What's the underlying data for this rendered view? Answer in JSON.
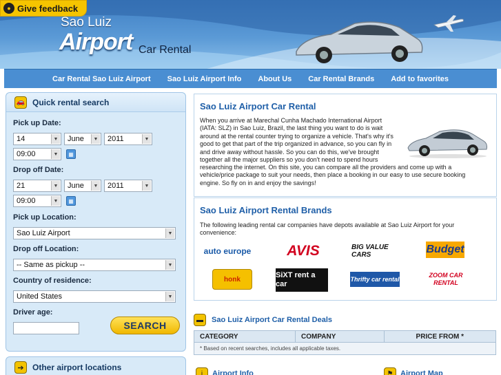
{
  "feedback": {
    "label": "Give feedback"
  },
  "logo": {
    "top": "Sao Luiz",
    "main": "Airport",
    "sub": "Car Rental"
  },
  "nav": [
    "Car Rental Sao Luiz Airport",
    "Sao Luiz Airport Info",
    "About Us",
    "Car Rental Brands",
    "Add to favorites"
  ],
  "search": {
    "title": "Quick rental search",
    "pickup_date_label": "Pick up Date:",
    "pickup_day": "14",
    "pickup_month": "June",
    "pickup_year": "2011",
    "pickup_time": "09:00",
    "dropoff_date_label": "Drop off Date:",
    "dropoff_day": "21",
    "dropoff_month": "June",
    "dropoff_year": "2011",
    "dropoff_time": "09:00",
    "pickup_location_label": "Pick up Location:",
    "pickup_location": "Sao Luiz Airport",
    "dropoff_location_label": "Drop off Location:",
    "dropoff_location": "-- Same as pickup --",
    "country_label": "Country of residence:",
    "country": "United States",
    "age_label": "Driver age:",
    "age_value": "",
    "button": "SEARCH"
  },
  "other": {
    "title": "Other airport locations"
  },
  "intro": {
    "title": "Sao Luiz Airport Car Rental",
    "text1": "When you arrive at Marechal Cunha Machado International Airport (IATA: SLZ) in Sao Luiz, Brazil, the last thing you want to do is wait around at the rental counter trying to organize a vehicle. That's why it's good to get that part of the trip organized in advance, so you can fly in and drive away without hassle. So you can do this, we've brought together all the major suppliers so you don't need to spend hours",
    "text2": "researching the internet. On this site, you can compare all the providers and come up with a vehicle/price package to suit your needs, then place a booking in our easy to use secure booking engine. So fly on in and enjoy the savings!"
  },
  "brands": {
    "title": "Sao Luiz Airport Rental Brands",
    "text": "The following leading rental car companies have depots available at Sao Luiz Airport for your convenience:",
    "items": [
      "auto europe",
      "AVIS",
      "BIG VALUE CARS",
      "Budget",
      "honk",
      "SiXT rent a car",
      "Thrifty car rental",
      "ZOOM CAR RENTAL"
    ]
  },
  "deals": {
    "title": "Sao Luiz Airport Car Rental Deals",
    "col_category": "CATEGORY",
    "col_company": "COMPANY",
    "col_price": "PRICE FROM *",
    "note": "* Based on recent searches, includes all applicable taxes."
  },
  "footer": {
    "info": "Airport Info",
    "map": "Airport Map"
  }
}
